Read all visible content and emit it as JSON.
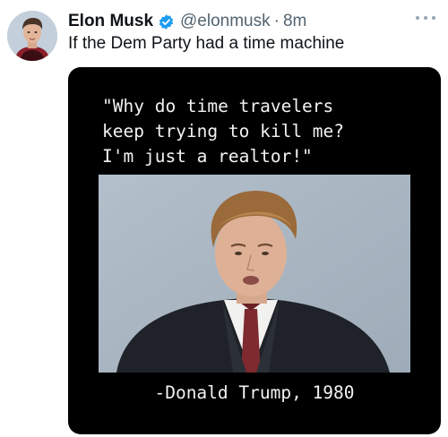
{
  "tweet": {
    "author_name": "Elon Musk",
    "handle": "@elonmusk",
    "separator": "·",
    "time": "8m",
    "text": "If the Dem Party had a time machine",
    "more_icon": "more-horizontal-icon",
    "verified_icon": "verified-badge-icon"
  },
  "media": {
    "quote_lines": [
      "\"Why do time travelers",
      "keep trying to kill me?",
      "I'm just a realtor!\""
    ],
    "attribution": "-Donald Trump, 1980"
  },
  "colors": {
    "name": "#0f1419",
    "secondary": "#536471",
    "verified": "#1d9bf0",
    "media_background": "#000000"
  }
}
